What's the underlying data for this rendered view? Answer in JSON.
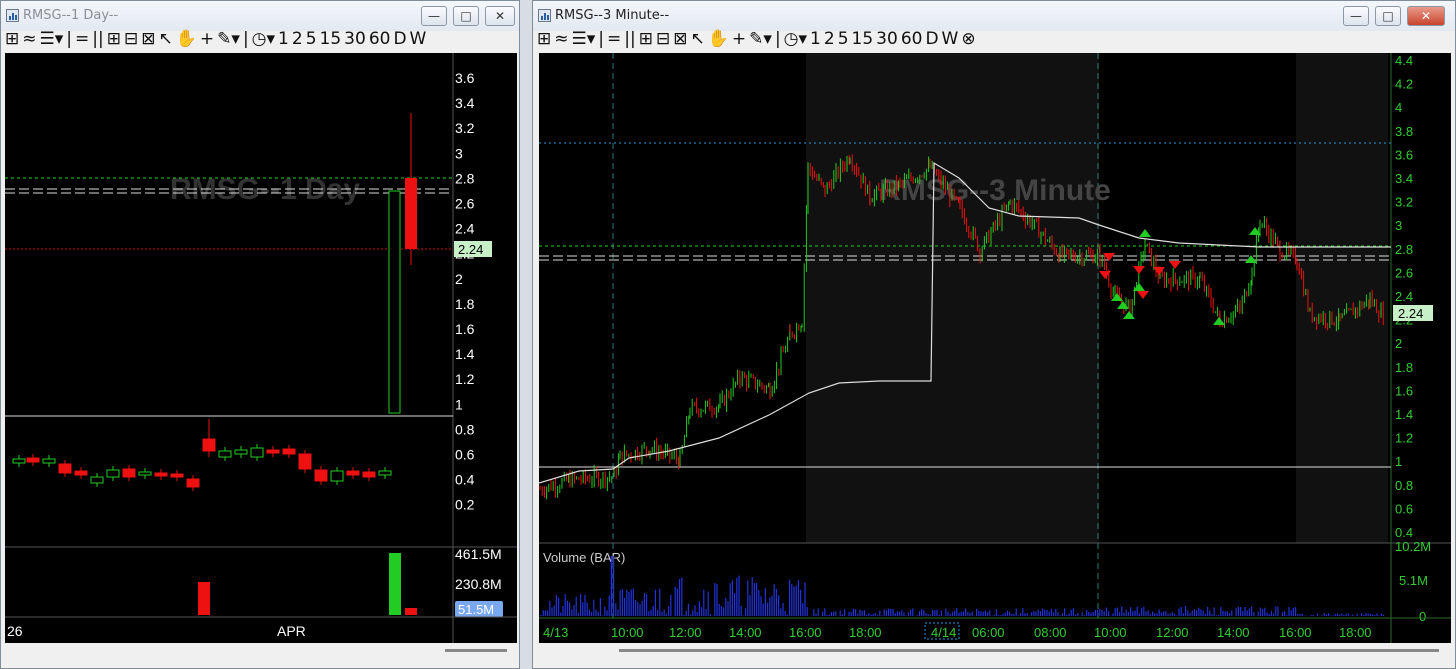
{
  "left_window": {
    "title": "RMSG--1 Day--",
    "toolbar": [
      "⊞",
      "≈",
      "☰▾",
      "|",
      "=",
      "||",
      "⊞",
      "⊟",
      "⊠",
      "↖",
      "✋",
      "+",
      "✎▾",
      "|",
      "◷▾",
      "1",
      "2",
      "5",
      "15",
      "30",
      "60",
      "D",
      "W"
    ],
    "watermark": "RMSG--1 Day",
    "price_axis": [
      "3.6",
      "3.4",
      "3.2",
      "3",
      "2.8",
      "2.6",
      "2.4",
      "2.2",
      "2",
      "1.8",
      "1.6",
      "1.4",
      "1.2",
      "1",
      "0.8",
      "0.6",
      "0.4",
      "0.2"
    ],
    "last_price": "2.24",
    "volume_axis": [
      "461.5M",
      "230.8M"
    ],
    "volume_last": "51.5M",
    "date_axis": [
      "26",
      "APR"
    ]
  },
  "right_window": {
    "title": "RMSG--3 Minute--",
    "toolbar": [
      "⊞",
      "≈",
      "☰▾",
      "|",
      "=",
      "||",
      "⊞",
      "⊟",
      "⊠",
      "↖",
      "✋",
      "+",
      "✎▾",
      "|",
      "◷▾",
      "1",
      "2",
      "5",
      "15",
      "30",
      "60",
      "D",
      "W",
      "⊗"
    ],
    "watermark": "RMSG--3 Minute",
    "price_axis": [
      "4.4",
      "4.2",
      "4",
      "3.8",
      "3.6",
      "3.4",
      "3.2",
      "3",
      "2.8",
      "2.6",
      "2.4",
      "2.2",
      "2",
      "1.8",
      "1.6",
      "1.4",
      "1.2",
      "1",
      "0.8",
      "0.6",
      "0.4"
    ],
    "last_price": "2.24",
    "volume_label": "Volume (BAR)",
    "volume_axis": [
      "10.2M",
      "5.1M",
      "0"
    ],
    "time_axis": [
      "4/13",
      "10:00",
      "12:00",
      "14:00",
      "16:00",
      "18:00",
      "4/14",
      "06:00",
      "08:00",
      "10:00",
      "12:00",
      "14:00",
      "16:00",
      "18:00"
    ]
  },
  "colors": {
    "up": "#22cc22",
    "down": "#ee1111",
    "axis_text": "#33cc33",
    "white_text": "#ffffff",
    "volume_blue": "#2233dd"
  },
  "window_buttons": {
    "minimize": "—",
    "maximize": "□",
    "close": "✕"
  }
}
